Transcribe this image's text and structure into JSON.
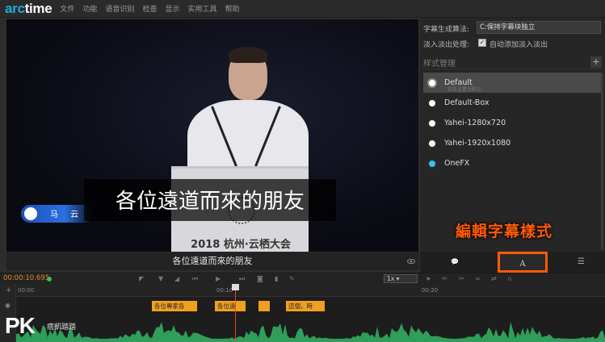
{
  "app": {
    "logo_arc": "arc",
    "logo_time": "time"
  },
  "menu": [
    "文件",
    "功能",
    "语音识别",
    "检查",
    "显示",
    "实用工具",
    "帮助"
  ],
  "video": {
    "caption": "各位遠道而來的朋友",
    "lower_third_name": "马 云",
    "podium_text": "2018 杭州·云栖大会"
  },
  "subtitle_line": "各位遠道而來的朋友",
  "right_panel": {
    "algo_label": "字幕生成算法:",
    "algo_value": "C:保持字幕块独立",
    "fade_label": "淡入淡出处理:",
    "fade_check_label": "自动添加淡入淡出",
    "fade_checked": true,
    "style_header": "样式管理",
    "styles": [
      {
        "name": "Default",
        "selected": true,
        "hint": "双击设置为默认",
        "color": "#ffffff"
      },
      {
        "name": "Default-Box",
        "selected": false,
        "color": "#ffffff"
      },
      {
        "name": "Yahei-1280x720",
        "selected": false,
        "color": "#ffffff"
      },
      {
        "name": "Yahei-1920x1080",
        "selected": false,
        "color": "#ffffff"
      },
      {
        "name": "OneFX",
        "selected": false,
        "color": "#39c2f0"
      }
    ],
    "tabs": [
      {
        "name": "comment-icon",
        "label": "💬"
      },
      {
        "name": "style-icon",
        "label": "A"
      },
      {
        "name": "list-icon",
        "label": "☰"
      }
    ]
  },
  "annotation": "編輯字幕樣式",
  "toolbar": {
    "timecode": "00:00:10.695",
    "speed": "1x"
  },
  "timeline": {
    "ticks": [
      "00:00",
      "00:10",
      "00:20"
    ],
    "cues": [
      "各位專家各",
      "各位遠",
      "",
      "這個，時"
    ]
  },
  "watermark": {
    "brand": "PK",
    "sub": "痞凱踏踏"
  },
  "colors": {
    "accent": "#22a7d6",
    "annotation": "#ff5a0a",
    "cue": "#f0a020",
    "timecode": "#e08a2a",
    "playhead": "#e04a1a"
  }
}
